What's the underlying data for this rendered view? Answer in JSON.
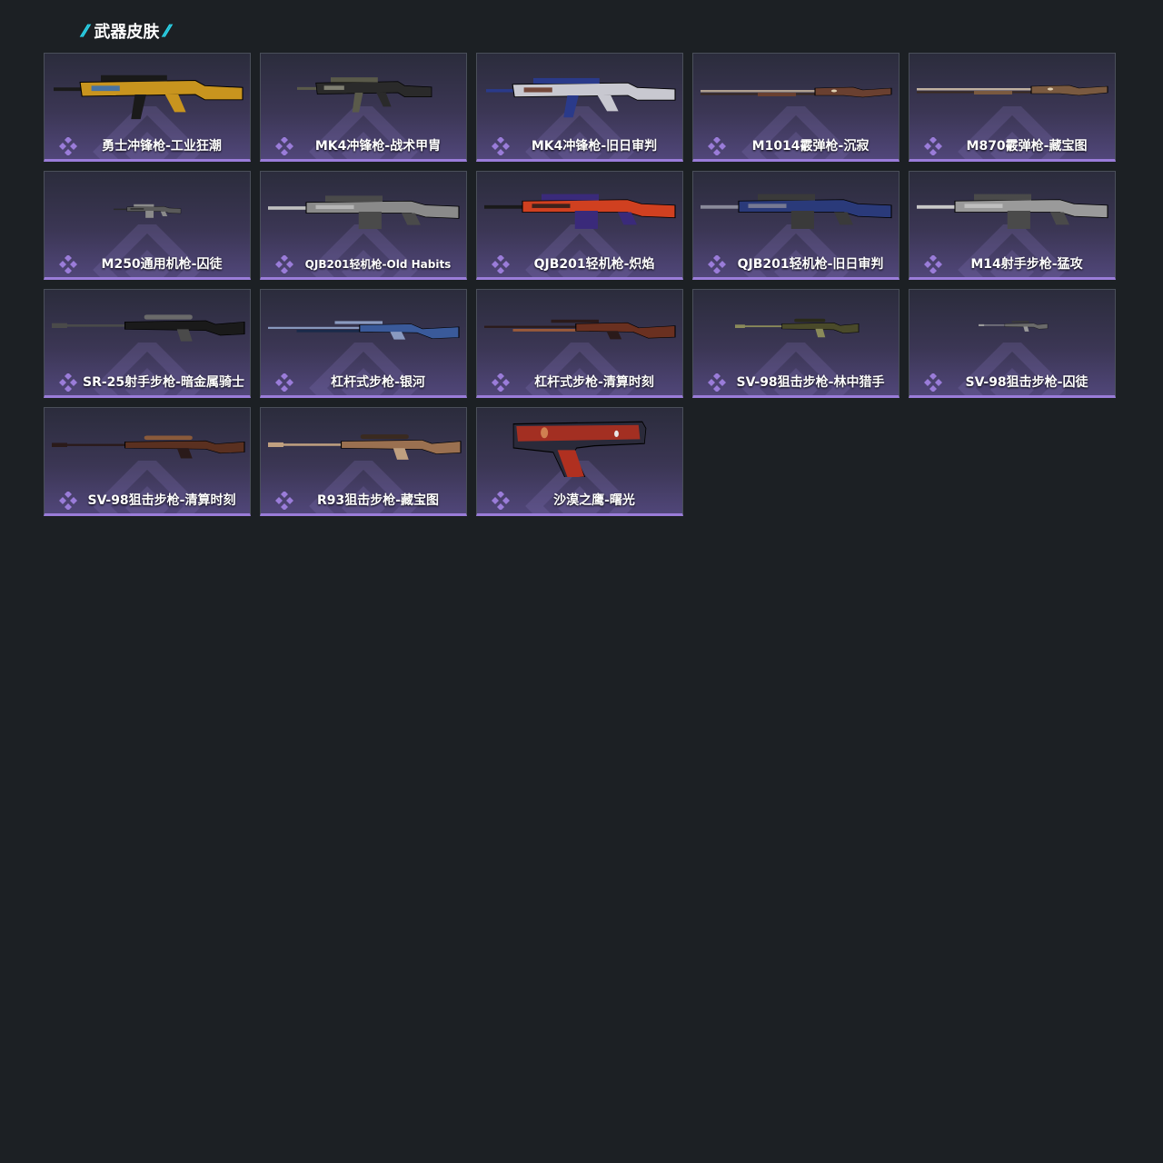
{
  "section": {
    "title": "武器皮肤",
    "decor": "//",
    "accent_color": "#2ad4ea",
    "rarity_color": "#9a7cd9"
  },
  "weapons": [
    {
      "name": "勇士冲锋枪-工业狂潮",
      "icon": "gold-smg-icon",
      "palette": [
        "#c8941e",
        "#1a1a1a",
        "#3a6fb0"
      ]
    },
    {
      "name": "MK4冲锋枪-战术甲胄",
      "icon": "black-smg-icon",
      "palette": [
        "#2a2a2a",
        "#5a5a4a",
        "#8a8a7a"
      ]
    },
    {
      "name": "MK4冲锋枪-旧日审判",
      "icon": "blue-silver-smg-icon",
      "palette": [
        "#c8c8d0",
        "#2a3a8a",
        "#6a3a2a"
      ]
    },
    {
      "name": "M1014霰弹枪-沉寂",
      "icon": "brown-shotgun-icon",
      "palette": [
        "#6a4030",
        "#b0a090",
        "#3a2a20"
      ]
    },
    {
      "name": "M870霰弹枪-藏宝图",
      "icon": "map-shotgun-icon",
      "palette": [
        "#7a5a40",
        "#c0b0a0",
        "#3a2a20"
      ]
    },
    {
      "name": "M250通用机枪-囚徒",
      "icon": "small-mg-icon",
      "palette": [
        "#5a5a5a",
        "#8a8a8a",
        "#2a2a2a"
      ]
    },
    {
      "name": "QJB201轻机枪-Old Habits",
      "icon": "grey-lmg-icon",
      "palette": [
        "#8a8a8a",
        "#4a4a4a",
        "#c0c0c0"
      ]
    },
    {
      "name": "QJB201轻机枪-炽焰",
      "icon": "flame-lmg-icon",
      "palette": [
        "#d04020",
        "#3a2a7a",
        "#1a1a1a"
      ]
    },
    {
      "name": "QJB201轻机枪-旧日审判",
      "icon": "blue-lmg-icon",
      "palette": [
        "#2a3a7a",
        "#3a3a3a",
        "#8a8a9a"
      ]
    },
    {
      "name": "M14射手步枪-猛攻",
      "icon": "grey-dmr-icon",
      "palette": [
        "#9a9a9a",
        "#4a4a4a",
        "#c8c8c8"
      ]
    },
    {
      "name": "SR-25射手步枪-暗金属骑士",
      "icon": "black-dmr-icon",
      "palette": [
        "#1a1a1a",
        "#4a4a4a",
        "#6a6a6a"
      ]
    },
    {
      "name": "杠杆式步枪-银河",
      "icon": "galaxy-rifle-icon",
      "palette": [
        "#3a5a9a",
        "#8a9ac0",
        "#1a2a4a"
      ]
    },
    {
      "name": "杠杆式步枪-清算时刻",
      "icon": "wood-rifle-icon",
      "palette": [
        "#6a3020",
        "#2a1a1a",
        "#9a5a3a"
      ]
    },
    {
      "name": "SV-98狙击步枪-林中猎手",
      "icon": "camo-sniper-icon",
      "palette": [
        "#4a4a2a",
        "#8a8a5a",
        "#2a2a1a"
      ]
    },
    {
      "name": "SV-98狙击步枪-囚徒",
      "icon": "small-sniper-icon",
      "palette": [
        "#6a6a6a",
        "#9a9a9a",
        "#3a3a3a"
      ]
    },
    {
      "name": "SV-98狙击步枪-清算时刻",
      "icon": "wood-sniper-icon",
      "palette": [
        "#5a3020",
        "#2a1a1a",
        "#8a5a3a"
      ]
    },
    {
      "name": "R93狙击步枪-藏宝图",
      "icon": "map-sniper-icon",
      "palette": [
        "#9a7050",
        "#c0a080",
        "#3a2a20"
      ]
    },
    {
      "name": "沙漠之鹰-曙光",
      "icon": "desert-eagle-icon",
      "palette": [
        "#b03020",
        "#2a2a3a",
        "#d08050"
      ]
    }
  ]
}
